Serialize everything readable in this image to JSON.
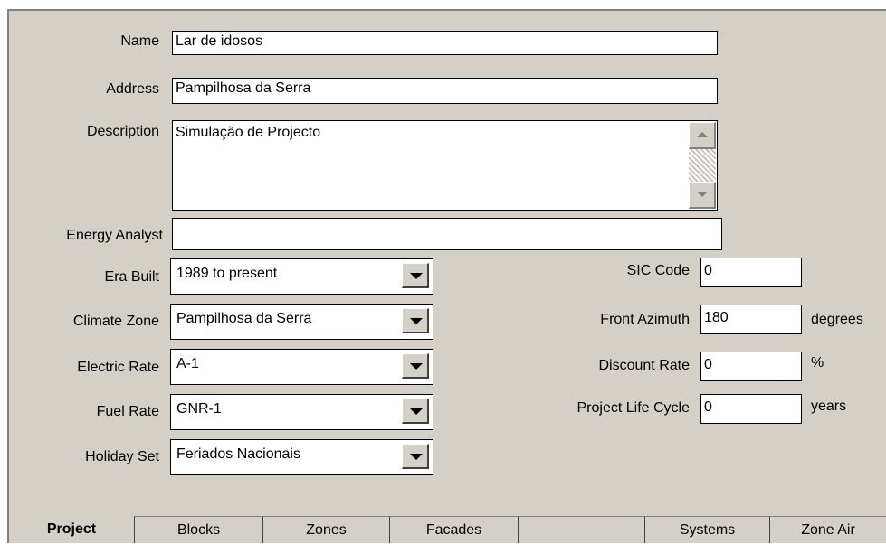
{
  "fields": {
    "name": {
      "label": "Name",
      "value": "Lar de idosos"
    },
    "address": {
      "label": "Address",
      "value": "Pampilhosa da Serra"
    },
    "description": {
      "label": "Description",
      "value": "Simulação de Projecto"
    },
    "energy_analyst": {
      "label": "Energy Analyst",
      "value": ""
    }
  },
  "combos": {
    "era_built": {
      "label": "Era Built",
      "value": "1989 to present"
    },
    "climate_zone": {
      "label": "Climate Zone",
      "value": "Pampilhosa da Serra"
    },
    "electric_rate": {
      "label": "Electric Rate",
      "value": "A-1"
    },
    "fuel_rate": {
      "label": "Fuel Rate",
      "value": "GNR-1"
    },
    "holiday_set": {
      "label": "Holiday Set",
      "value": "Feriados Nacionais"
    }
  },
  "right": {
    "sic_code": {
      "label": "SIC Code",
      "value": "0",
      "unit": ""
    },
    "front_azimuth": {
      "label": "Front Azimuth",
      "value": "180",
      "unit": "degrees"
    },
    "discount_rate": {
      "label": "Discount Rate",
      "value": "0",
      "unit": "%"
    },
    "project_life_cycle": {
      "label": "Project Life Cycle",
      "value": "0",
      "unit": "years"
    }
  },
  "tabs": [
    "Project",
    "Blocks",
    "Zones",
    "Facades",
    "",
    "Systems",
    "Zone Air"
  ]
}
